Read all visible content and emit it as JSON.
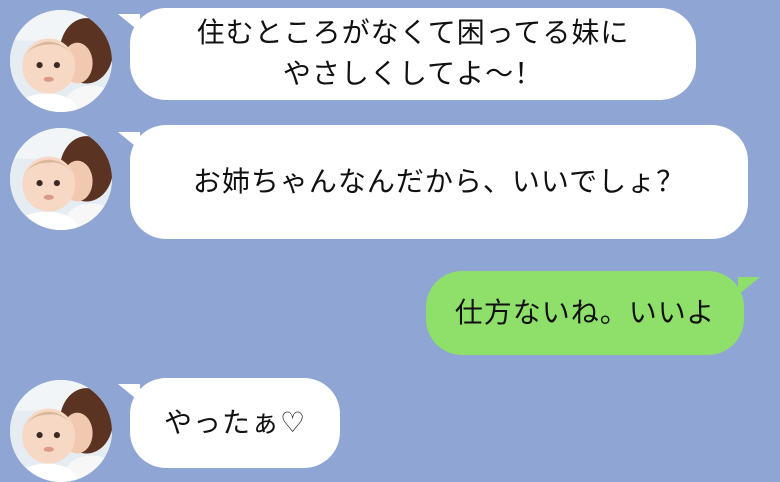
{
  "messages": [
    {
      "side": "incoming",
      "text": "住むところがなくて困ってる妹に\nやさしくしてよ～！"
    },
    {
      "side": "incoming",
      "text": "お姉ちゃんなんだから、いいでしょ？"
    },
    {
      "side": "outgoing",
      "text": "仕方ないね。いいよ"
    },
    {
      "side": "incoming",
      "text": "やったぁ♡"
    }
  ],
  "colors": {
    "background": "#8fa5d4",
    "incoming_bubble": "#ffffff",
    "outgoing_bubble": "#8ee06b"
  },
  "avatar_icon": "mother-and-baby-photo"
}
